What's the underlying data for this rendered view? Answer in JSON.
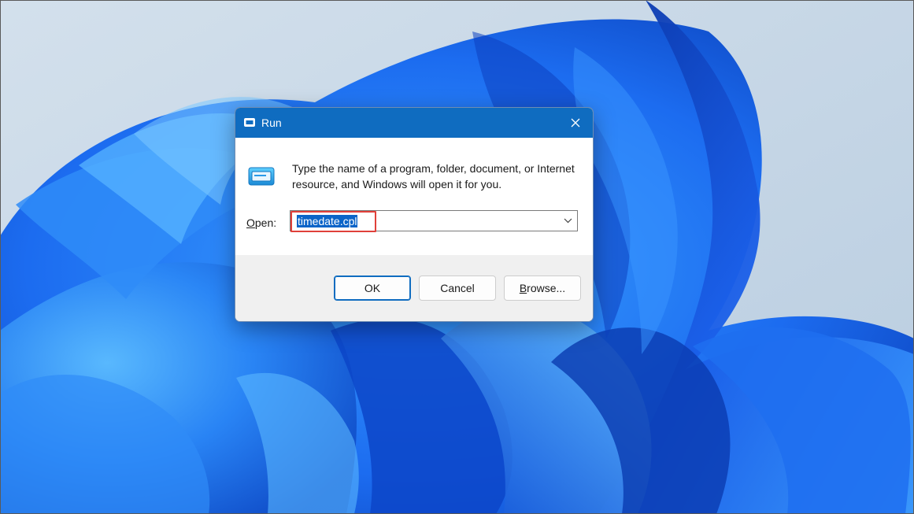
{
  "dialog": {
    "title": "Run",
    "close_symbol": "✕",
    "description": "Type the name of a program, folder, document, or Internet resource, and Windows will open it for you.",
    "open_label_accel": "O",
    "open_label_rest": "pen:",
    "open_value": "timedate.cpl",
    "buttons": {
      "ok": "OK",
      "cancel": "Cancel",
      "browse_accel": "B",
      "browse_rest": "rowse..."
    }
  },
  "icons": {
    "title": "run-icon",
    "main": "run-icon",
    "close": "close-icon",
    "dropdown": "chevron-down-icon"
  },
  "colors": {
    "titlebar": "#0f6cc0",
    "selection": "#0a64c8",
    "highlight_box": "#e0403a",
    "wallpaper_blue": "#1a5ee8"
  }
}
